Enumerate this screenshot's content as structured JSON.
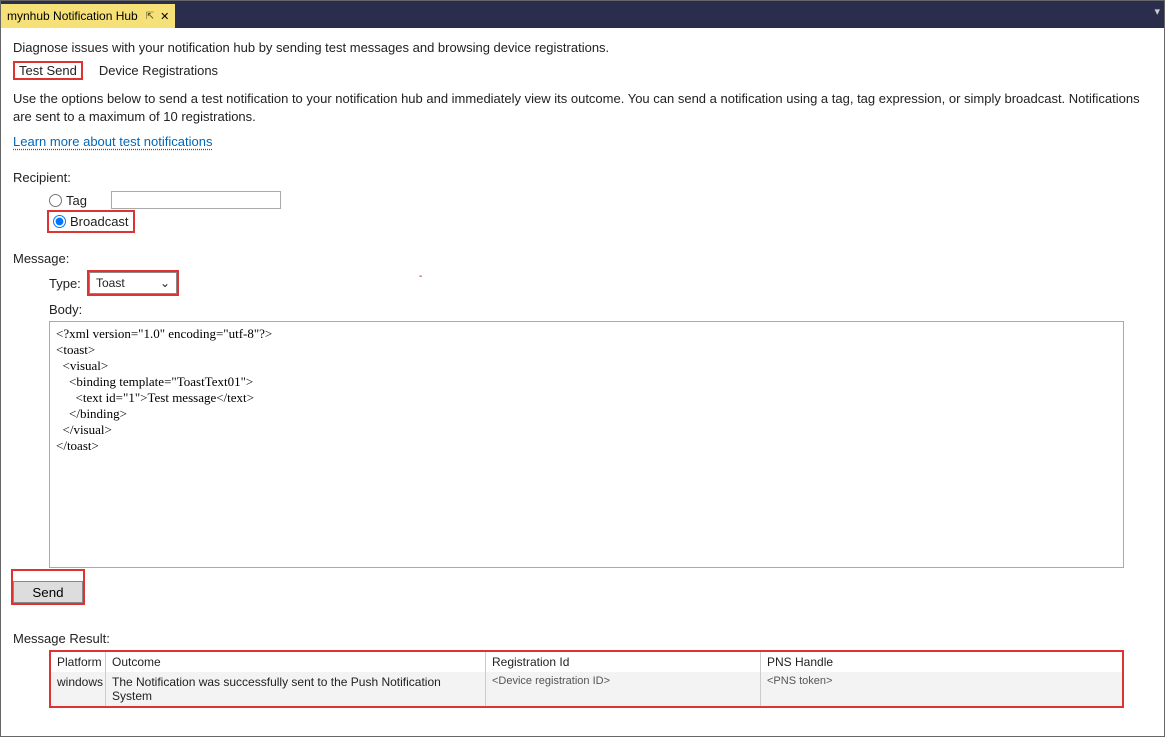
{
  "titlebar": {
    "tab_title": "mynhub Notification Hub"
  },
  "header": {
    "description": "Diagnose issues with your notification hub by sending test messages and browsing device registrations."
  },
  "subtabs": {
    "test_send": "Test Send",
    "device_registrations": "Device Registrations"
  },
  "help": {
    "text": "Use the options below to send a test notification to your notification hub and immediately view its outcome. You can send a notification using a tag, tag expression, or simply broadcast. Notifications are sent to a maximum of 10 registrations.",
    "link": "Learn more about test notifications"
  },
  "recipient": {
    "label": "Recipient:",
    "tag_label": "Tag",
    "tag_value": "",
    "broadcast_label": "Broadcast",
    "selected": "broadcast"
  },
  "message": {
    "label": "Message:",
    "type_label": "Type:",
    "type_value": "Toast",
    "body_label": "Body:",
    "body_value": "<?xml version=\"1.0\" encoding=\"utf-8\"?>\n<toast>\n  <visual>\n    <binding template=\"ToastText01\">\n      <text id=\"1\">Test message</text>\n    </binding>\n  </visual>\n</toast>"
  },
  "actions": {
    "send": "Send"
  },
  "result": {
    "label": "Message Result:",
    "headers": {
      "platform": "Platform",
      "outcome": "Outcome",
      "registration": "Registration Id",
      "pns": "PNS Handle"
    },
    "row": {
      "platform": "windows",
      "outcome": "The Notification was successfully sent to the Push Notification System",
      "registration": "<Device registration ID>",
      "pns": "<PNS token>"
    }
  }
}
